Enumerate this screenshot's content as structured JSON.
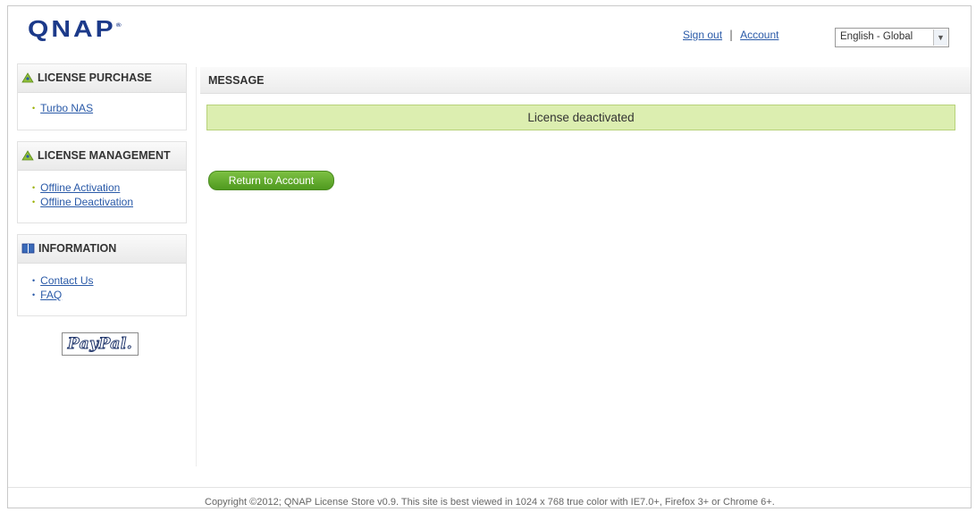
{
  "header": {
    "logo_text": "QNAP",
    "logo_mark": "®",
    "sign_out_label": "Sign out",
    "separator": "|",
    "account_label": "Account",
    "language": {
      "selected": "English - Global",
      "arrow_icon": "chevron-down-icon"
    }
  },
  "sidebar": {
    "sections": [
      {
        "title": "LICENSE PURCHASE",
        "icon": "triangle-users-icon",
        "items": [
          {
            "label": "Turbo NAS"
          }
        ]
      },
      {
        "title": "LICENSE MANAGEMENT",
        "icon": "triangle-users-icon",
        "items": [
          {
            "label": "Offline Activation"
          },
          {
            "label": "Offline Deactivation"
          }
        ]
      },
      {
        "title": "INFORMATION",
        "icon": "book-icon",
        "items": [
          {
            "label": "Contact Us"
          },
          {
            "label": "FAQ"
          }
        ]
      }
    ],
    "paypal_logo_text": "PayPal."
  },
  "main": {
    "section_title": "MESSAGE",
    "notice_text": "License deactivated",
    "return_button_label": "Return to Account"
  },
  "footer": {
    "text": "Copyright ©2012; QNAP License Store v0.9.  This site is best viewed in 1024 x 768 true color with IE7.0+, Firefox 3+ or Chrome 6+."
  },
  "colors": {
    "logo": "#1c3a8a",
    "link": "#2a5aa8",
    "notice_bg": "#dceeb0",
    "button_green": "#5ea82a"
  }
}
